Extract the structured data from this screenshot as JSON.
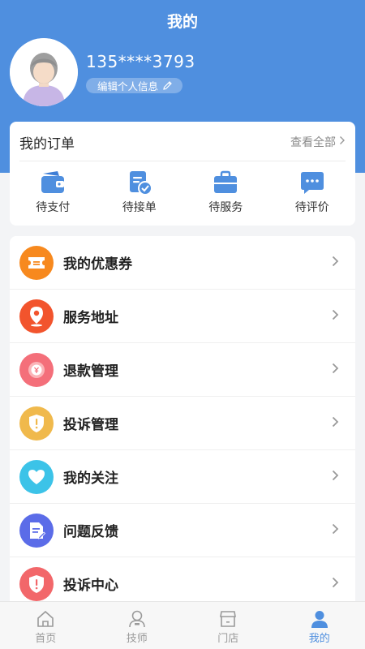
{
  "header": {
    "title": "我的",
    "phone": "135****3793",
    "edit_label": "编辑个人信息"
  },
  "orders": {
    "title": "我的订单",
    "view_all": "查看全部",
    "items": [
      {
        "label": "待支付",
        "icon": "wallet-icon"
      },
      {
        "label": "待接单",
        "icon": "clipboard-check-icon"
      },
      {
        "label": "待服务",
        "icon": "briefcase-icon"
      },
      {
        "label": "待评价",
        "icon": "chat-bubble-icon"
      }
    ]
  },
  "menu": {
    "items": [
      {
        "label": "我的优惠券",
        "icon": "coupon-icon",
        "color": "#f7891e"
      },
      {
        "label": "服务地址",
        "icon": "location-pin-icon",
        "color": "#f2542d"
      },
      {
        "label": "退款管理",
        "icon": "refund-icon",
        "color": "#f46f7a"
      },
      {
        "label": "投诉管理",
        "icon": "complaint-shield-icon",
        "color": "#f0b94c"
      },
      {
        "label": "我的关注",
        "icon": "heart-icon",
        "color": "#3cc3e8"
      },
      {
        "label": "问题反馈",
        "icon": "feedback-document-icon",
        "color": "#5b6ce8"
      },
      {
        "label": "投诉中心",
        "icon": "complaint-center-icon",
        "color": "#f2676a"
      }
    ]
  },
  "tabbar": {
    "items": [
      {
        "label": "首页",
        "icon": "home-icon",
        "active": false
      },
      {
        "label": "技师",
        "icon": "technician-icon",
        "active": false
      },
      {
        "label": "门店",
        "icon": "store-icon",
        "active": false
      },
      {
        "label": "我的",
        "icon": "profile-icon",
        "active": true
      }
    ]
  },
  "colors": {
    "primary": "#4f8fdf",
    "background": "#f3f4f6"
  }
}
